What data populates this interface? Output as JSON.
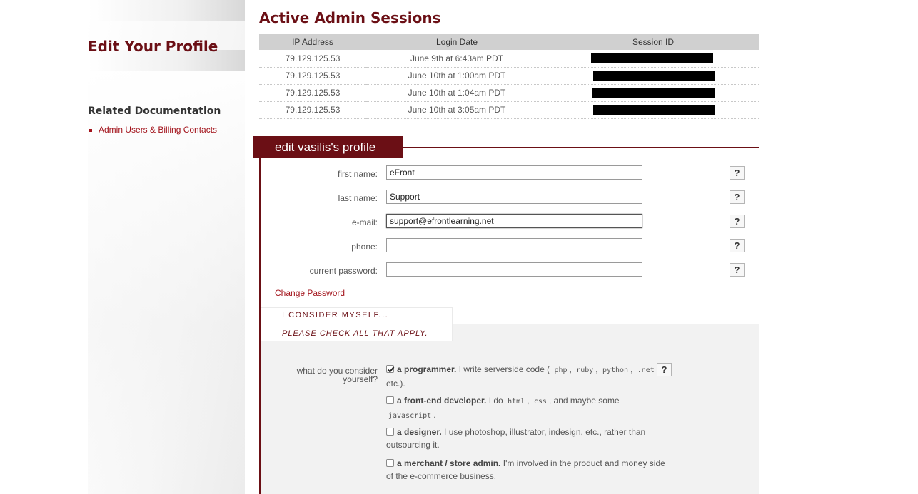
{
  "sidebar": {
    "title": "Edit Your Profile",
    "related_title": "Related Documentation",
    "related_links": [
      "Admin Users & Billing Contacts"
    ]
  },
  "sessions": {
    "title": "Active Admin Sessions",
    "columns": [
      "IP Address",
      "Login Date",
      "Session ID"
    ],
    "rows": [
      {
        "ip": "79.129.125.53",
        "date": "June 9th at 6:43am PDT"
      },
      {
        "ip": "79.129.125.53",
        "date": "June 10th at 1:00am PDT"
      },
      {
        "ip": "79.129.125.53",
        "date": "June 10th at 1:04am PDT"
      },
      {
        "ip": "79.129.125.53",
        "date": "June 10th at 3:05am PDT"
      }
    ]
  },
  "profile": {
    "tab_title": "edit vasilis's profile",
    "fields": {
      "first_name": {
        "label": "first name:",
        "value": "eFront"
      },
      "last_name": {
        "label": "last name:",
        "value": "Support"
      },
      "email": {
        "label": "e-mail:",
        "value": "support@efrontlearning.net"
      },
      "phone": {
        "label": "phone:",
        "value": ""
      },
      "password": {
        "label": "current password:",
        "value": ""
      }
    },
    "help_label": "?",
    "change_password": "Change Password",
    "consider_title": "I CONSIDER MYSELF...",
    "consider_hint": "PLEASE CHECK ALL THAT APPLY.",
    "question": "what do you consider yourself?",
    "options": {
      "programmer": {
        "title": "a programmer.",
        "text_before": "I write serverside code (",
        "codes": [
          "php",
          "ruby",
          "python",
          ".net"
        ],
        "text_after": "etc.).",
        "checked": true
      },
      "frontend": {
        "title": "a front-end developer.",
        "text_before": "I do",
        "codes": [
          "html",
          "css",
          "javascript"
        ],
        "text_mid": ", and maybe some",
        "checked": false
      },
      "designer": {
        "title": "a designer.",
        "text": "I use photoshop, illustrator, indesign, etc., rather than outsourcing it.",
        "checked": false
      },
      "merchant": {
        "title": "a merchant / store admin.",
        "text": "I'm involved in the product and money side of the e-commerce business.",
        "checked": false
      }
    }
  }
}
